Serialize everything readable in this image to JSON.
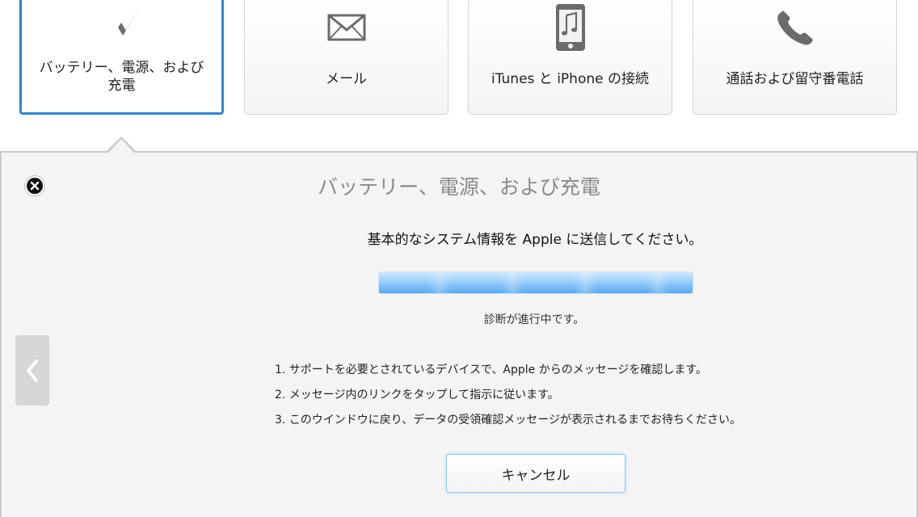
{
  "tiles": [
    {
      "label": "バッテリー、電源、および充電",
      "icon": "lightning-bolt-icon",
      "selected": true
    },
    {
      "label": "メール",
      "icon": "envelope-icon",
      "selected": false
    },
    {
      "label": "iTunes と iPhone の接続",
      "icon": "iphone-music-icon",
      "selected": false
    },
    {
      "label": "通話および留守番電話",
      "icon": "phone-handset-icon",
      "selected": false
    }
  ],
  "panel": {
    "title": "バッテリー、電源、および充電",
    "instruction": "基本的なシステム情報を Apple に送信してください。",
    "progress_status": "診断が進行中です。",
    "steps": [
      "1.  サポートを必要とされているデバイスで、Apple からのメッセージを確認します。",
      "2.  メッセージ内のリンクをタップして指示に従います。",
      "3.  このウインドウに戻り、データの受領確認メッセージが表示されるまでお待ちください。"
    ],
    "cancel_label": "キャンセル"
  },
  "colors": {
    "accent": "#2f86d4",
    "icon_gray": "#6b6b6b",
    "title_gray": "#8a8a8a"
  }
}
